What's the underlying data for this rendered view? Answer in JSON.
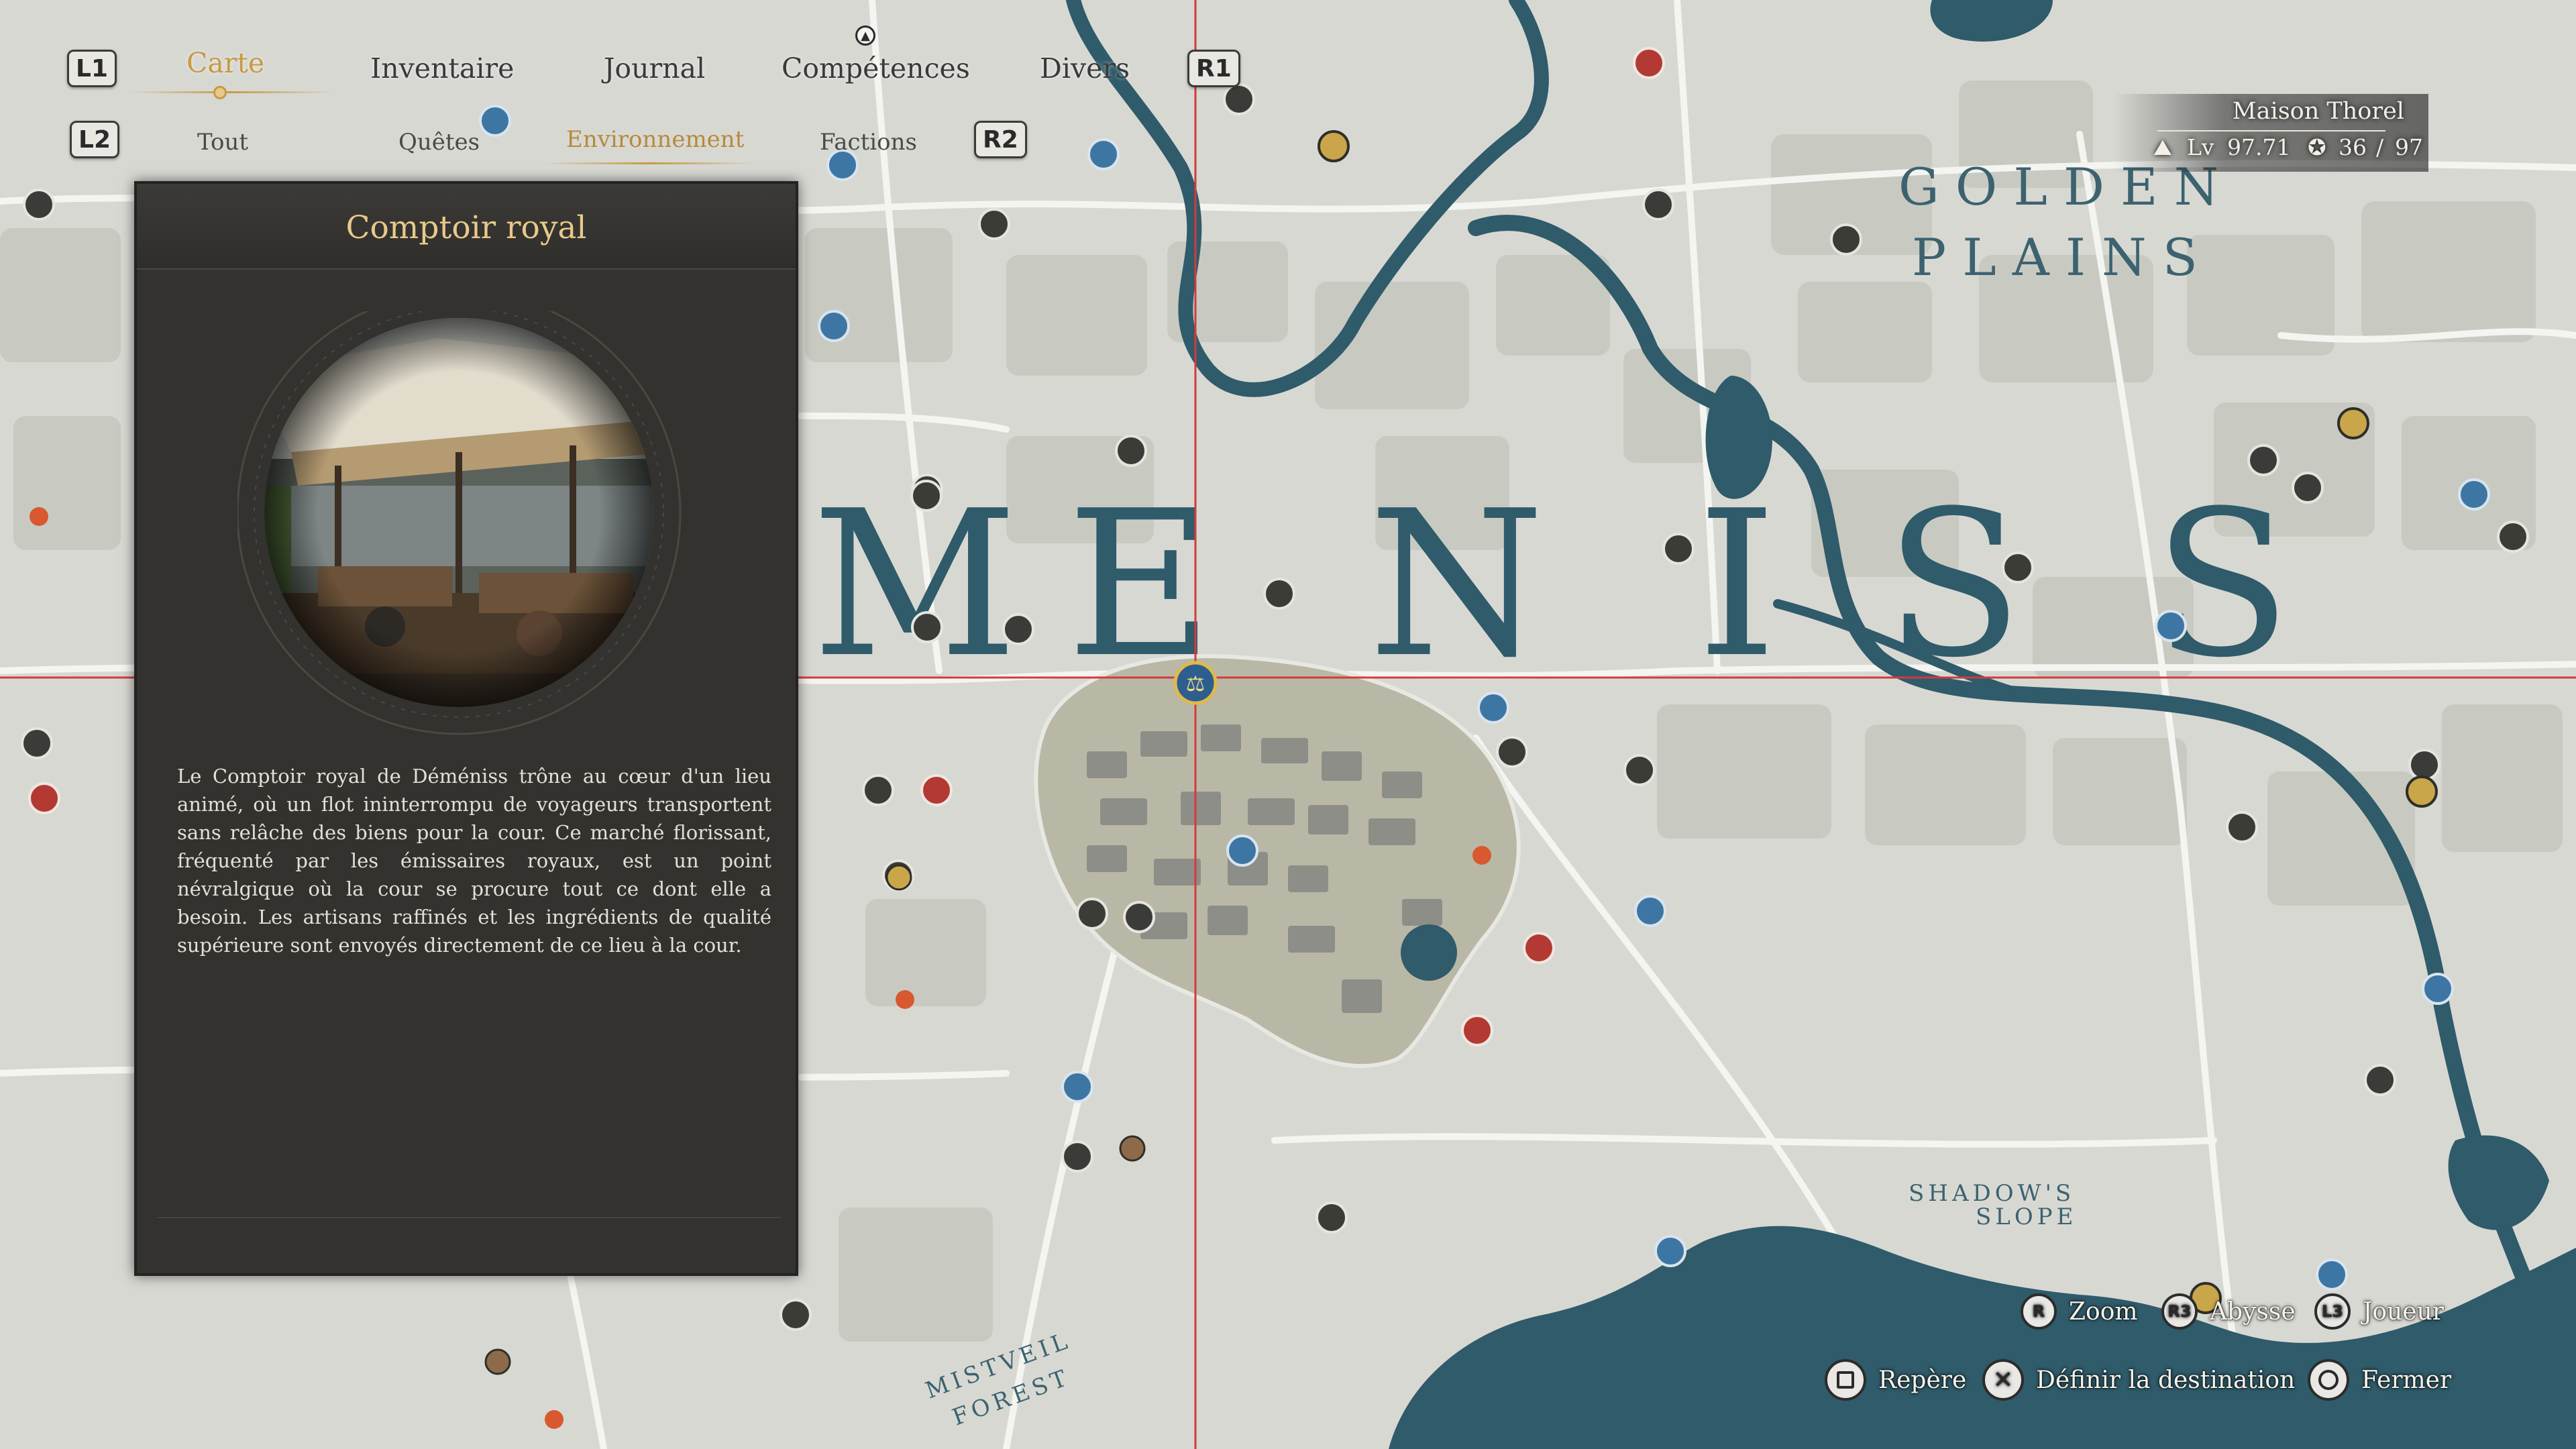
{
  "nav": {
    "l1": "L1",
    "r1": "R1",
    "l2": "L2",
    "r2": "R2",
    "tabs": [
      {
        "label": "Carte",
        "active": true
      },
      {
        "label": "Inventaire",
        "active": false
      },
      {
        "label": "Journal",
        "active": false
      },
      {
        "label": "Compétences",
        "active": false
      },
      {
        "label": "Divers",
        "active": false
      }
    ],
    "subtabs": [
      {
        "label": "Tout",
        "active": false
      },
      {
        "label": "Quêtes",
        "active": false
      },
      {
        "label": "Environnement",
        "active": true
      },
      {
        "label": "Factions",
        "active": false
      }
    ]
  },
  "panel": {
    "title": "Comptoir royal",
    "description": "Le Comptoir royal de Déméniss trône au cœur d'un lieu animé, où un flot ininterrompu de voyageurs transportent sans relâche des biens pour la cour. Ce marché florissant, fréquenté par les émissaires royaux, est un point névralgique où la cour se procure tout ce dont elle a besoin. Les artisans raffinés et les ingrédients de qualité supérieure sont envoyés directement de ce lieu à la cour."
  },
  "player": {
    "house": "Maison Thorel",
    "level_label": "Lv",
    "level": "97.71",
    "count": "36",
    "count_sep": "/",
    "count_max": "97"
  },
  "map": {
    "region_name": "MENISS",
    "region_letters": [
      "M",
      "E",
      "N",
      "I",
      "S",
      "S"
    ],
    "golden_line1": "G O L D E N",
    "golden_line2": "P L A I N S",
    "shadows1": "SHADOW'S",
    "shadows2": "SLOPE",
    "mist1": "MISTVEIL",
    "mist2": "FOREST",
    "colors": {
      "land": "#d8d8d3",
      "water": "#2f5b6a",
      "road": "#f0f0ec",
      "field": "#c9cbc2",
      "grid": "#d23b3b",
      "town": "#b9b8a6"
    }
  },
  "prompts": {
    "zoom_btn": "R",
    "zoom": "Zoom",
    "abyss_btn": "R3",
    "abyss": "Abysse",
    "player_btn": "L3",
    "player": "Joueur",
    "marker_btn": "square",
    "marker": "Repère",
    "dest_btn": "cross",
    "dest": "Définir la destination",
    "close_btn": "circle",
    "close": "Fermer"
  }
}
